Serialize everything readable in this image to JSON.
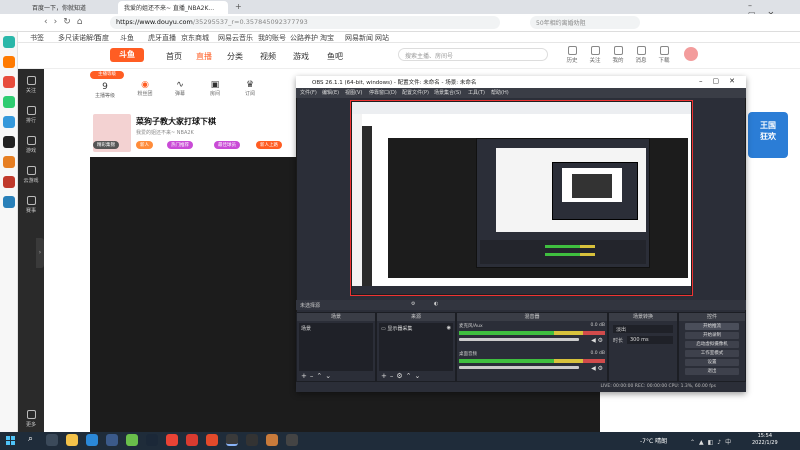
{
  "browser": {
    "tabs": [
      {
        "label": "百度一下，你就知道"
      },
      {
        "label": "我爱的姐还不来~ 直播_NBA2K..."
      }
    ],
    "url_host": "https://www.douyu.com",
    "url_path": "/35295537_r=0.357845092377793",
    "search_placeholder": "50年相约离婚劝阻",
    "bookmarks": [
      "书签",
      "多尺读诺解尔",
      "百度",
      "斗鱼",
      "虎牙直播",
      "京东商城",
      "网易云音乐",
      "我的账号",
      "公路养护",
      "淘宝",
      "网易新闻",
      "微博客服",
      "快购物",
      "网站"
    ]
  },
  "site": {
    "logo": "斗鱼",
    "nav": [
      {
        "label": "首页"
      },
      {
        "label": "直播"
      },
      {
        "label": "分类"
      },
      {
        "label": "视频"
      },
      {
        "label": "游戏"
      },
      {
        "label": "鱼吧"
      }
    ],
    "search_placeholder": "搜索主播、房间号",
    "header_icons": [
      "历史",
      "关注",
      "我的",
      "消息",
      "下载"
    ],
    "left_menu": [
      "关注",
      "排行",
      "游戏",
      "云游戏",
      "赛事",
      "更多"
    ],
    "stats": [
      {
        "num": "9",
        "label": "主播等级"
      },
      {
        "num": "",
        "label": "粉丝团"
      },
      {
        "num": "",
        "label": "弹幕"
      },
      {
        "num": "",
        "label": "房间"
      },
      {
        "num": "",
        "label": "订阅"
      }
    ],
    "stream_title": "菜狗子教大家打球下棋",
    "stream_sub": "我爱的姐还不来~ NBA2K",
    "pills": [
      "精彩集锦",
      "新人",
      "热门推荐",
      "最佳球员",
      "新人上路"
    ],
    "promo": "王国\n狂欢"
  },
  "obs": {
    "title": "OBS 26.1.1 (64-bit, windows) - 配置文件: 未命名 - 场景: 未命名",
    "menu": [
      "文件(F)",
      "编辑(E)",
      "视图(V)",
      "停靠窗口(D)",
      "配置文件(P)",
      "场景集合(S)",
      "工具(T)",
      "帮助(H)"
    ],
    "scene_bar_label": "未选择源",
    "dock_titles": [
      "场景",
      "来源",
      "混音器",
      "场景转换",
      "控件"
    ],
    "scene_item": "场景",
    "source_item": "显示器采集",
    "mixer": [
      {
        "name": "桌面音频",
        "db": "0.0 dB"
      },
      {
        "name": "麦克风/Aux",
        "db": "0.0 dB"
      }
    ],
    "transition": {
      "type": "淡出",
      "duration_label": "时长",
      "duration": "300 ms"
    },
    "controls": [
      "开始推流",
      "开始录制",
      "启动虚拟摄像机",
      "工作室模式",
      "设置",
      "退出"
    ],
    "status": "LIVE: 00:00:00   REC: 00:00:00   CPU: 1.3%, 60.00 fps"
  },
  "taskbar": {
    "weather": "-7°C 晴朗",
    "time": "15:54",
    "date": "2022/1/29"
  }
}
